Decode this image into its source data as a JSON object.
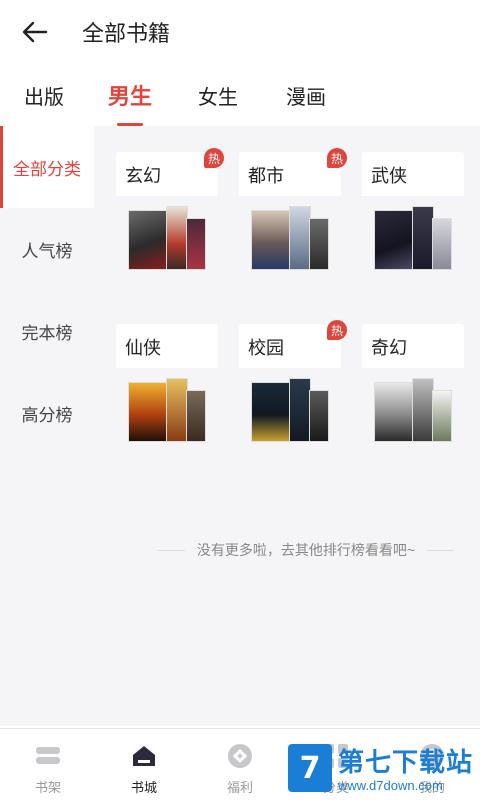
{
  "header": {
    "title": "全部书籍"
  },
  "tabs": [
    {
      "label": "出版",
      "active": false
    },
    {
      "label": "男生",
      "active": true
    },
    {
      "label": "女生",
      "active": false
    },
    {
      "label": "漫画",
      "active": false
    }
  ],
  "sidebar": {
    "items": [
      {
        "label": "全部分类",
        "active": true
      },
      {
        "label": "人气榜",
        "active": false
      },
      {
        "label": "完本榜",
        "active": false
      },
      {
        "label": "高分榜",
        "active": false
      }
    ]
  },
  "categories": [
    {
      "label": "玄幻",
      "badge": "热"
    },
    {
      "label": "都市",
      "badge": "热"
    },
    {
      "label": "武侠",
      "badge": ""
    },
    {
      "label": "仙侠",
      "badge": ""
    },
    {
      "label": "校园",
      "badge": "热"
    },
    {
      "label": "奇幻",
      "badge": ""
    }
  ],
  "footer_note": "没有更多啦，去其他排行榜看看吧~",
  "bottom_nav": [
    {
      "label": "书架",
      "icon": "bookshelf-icon",
      "active": false
    },
    {
      "label": "书城",
      "icon": "bookstore-icon",
      "active": true
    },
    {
      "label": "福利",
      "icon": "welfare-icon",
      "active": false
    },
    {
      "label": "分类",
      "icon": "category-icon",
      "active": false
    },
    {
      "label": "我的",
      "icon": "profile-icon",
      "active": false
    }
  ],
  "watermark": {
    "title": "第七下载站",
    "url": "www.d7down.com"
  },
  "colors": {
    "accent": "#e0443c",
    "background": "#f5f5f7",
    "watermark": "#1a7ed6"
  }
}
